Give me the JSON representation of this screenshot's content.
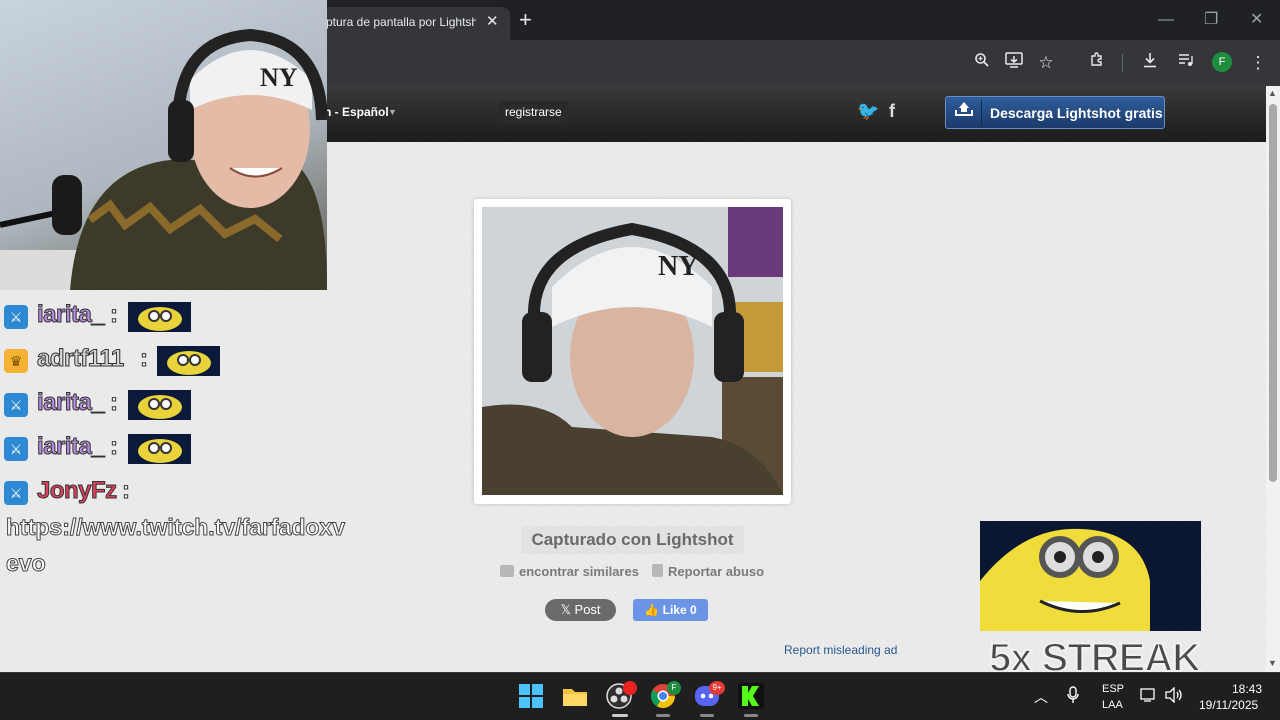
{
  "browser": {
    "tab_title": "ptura de pantalla por Lightsh",
    "tab_close": "✕",
    "new_tab": "+",
    "window_controls": {
      "minimize": "—",
      "restore": "❐",
      "close": "✕"
    },
    "toolbar_icons": [
      "zoom-icon",
      "install-app-icon",
      "star-icon",
      "extensions-icon",
      "download-icon",
      "media-control-icon",
      "menu-icon"
    ],
    "profile_initial": "F"
  },
  "site": {
    "language": "h - Español",
    "register": "registrarse",
    "social": {
      "twitter": "🐦",
      "facebook": "f"
    },
    "download_button": "Descarga Lightshot gratis",
    "captured_label": "Capturado con Lightshot",
    "find_similar": "encontrar similares",
    "report_abuse": "Reportar abuso",
    "x_post": "𝕏 Post",
    "fb_like": "👍 Like 0",
    "report_ad": "Report misleading ad"
  },
  "chat": {
    "messages": [
      {
        "user": "iarita_",
        "color": "#b68be0",
        "badge": "mod"
      },
      {
        "user": "adrtf111",
        "color": "#d6d6d6",
        "badge": "crown"
      },
      {
        "user": "iarita_",
        "color": "#b68be0",
        "badge": "mod"
      },
      {
        "user": "iarita_",
        "color": "#b68be0",
        "badge": "mod"
      },
      {
        "user": "JonyFz",
        "color": "#e0405e",
        "badge": "mod"
      }
    ],
    "separator": ":",
    "link_line1": "https://www.twitch.tv/farfadoxv",
    "link_line2": "evo"
  },
  "overlay": {
    "streak": "5x STREAK"
  },
  "taskbar": {
    "lang_top": "ESP",
    "lang_bottom": "LAA",
    "time": "18:43",
    "date": "19/11/2025",
    "chrome_badge": "F",
    "discord_badge": "9+"
  }
}
